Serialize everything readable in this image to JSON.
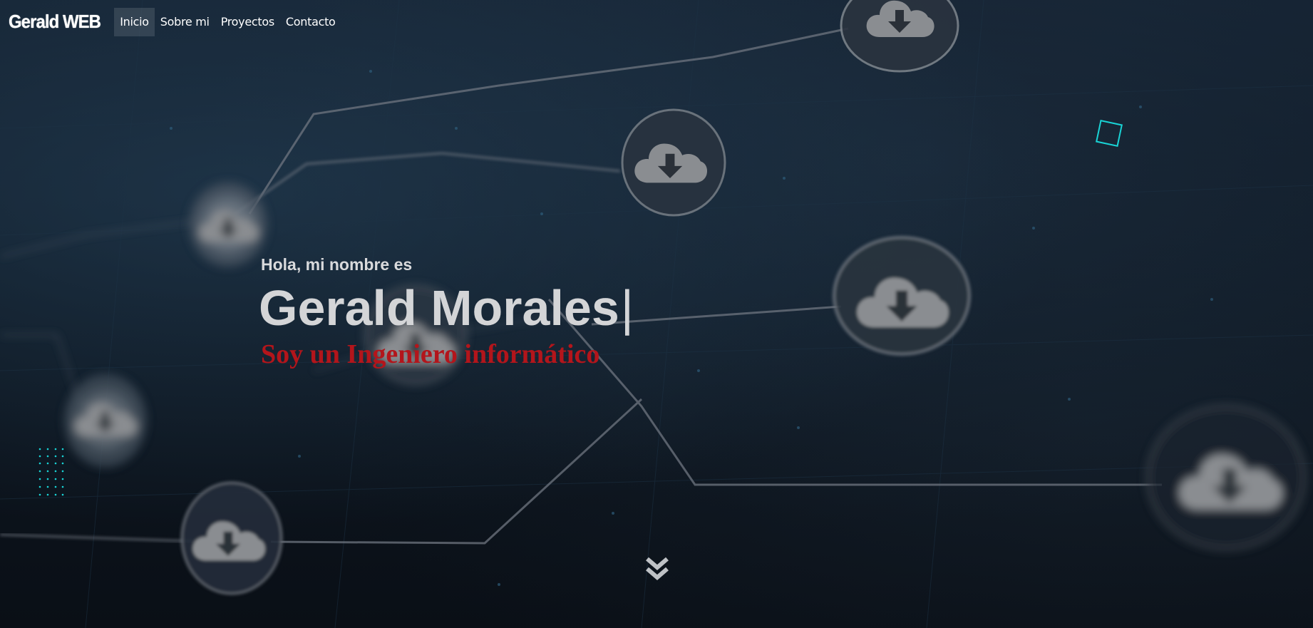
{
  "nav": {
    "brand": "Gerald WEB",
    "items": [
      {
        "label": "Inicio",
        "active": true
      },
      {
        "label": "Sobre mi",
        "active": false
      },
      {
        "label": "Proyectos",
        "active": false
      },
      {
        "label": "Contacto",
        "active": false
      }
    ]
  },
  "hero": {
    "greeting": "Hola, mi nombre es",
    "name": "Gerald Morales",
    "cursor": "|",
    "role": "Soy un Ingeniero informático"
  },
  "icons": {
    "scroll_down": "double-chevron-down-icon",
    "background_icons": "cloud-download-icon"
  },
  "colors": {
    "accent_cyan": "#19d4d6",
    "role_red": "#b3151b",
    "text_light": "#d4d5d7"
  }
}
